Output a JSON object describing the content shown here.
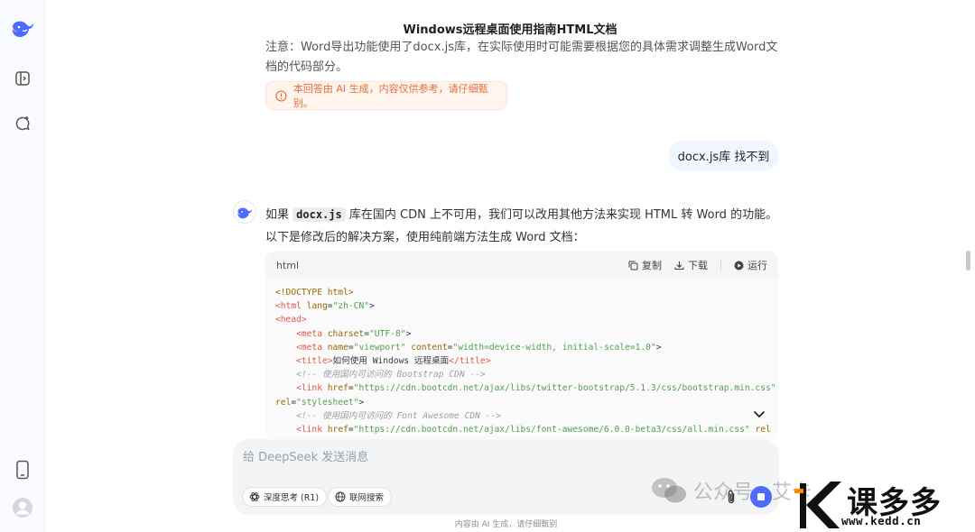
{
  "header": {
    "title": "Windows远程桌面使用指南HTML文档"
  },
  "sidebar": {
    "logo_icon": "deepseek-whale-icon",
    "toggle_icon": "sidebar-toggle-icon",
    "new_chat_icon": "new-chat-icon",
    "download_app_icon": "phone-icon",
    "profile_icon": "avatar-icon"
  },
  "chat": {
    "previous_note": "注意：Word导出功能使用了docx.js库，在实际使用时可能需要根据您的具体需求调整生成Word文档的代码部分。",
    "ai_warning": "本回答由 AI 生成，内容仅供参考，请仔细甄别。",
    "user_message": "docx.js库 找不到",
    "answer": {
      "prefix": "如果",
      "code_term": "docx.js",
      "rest": "库在国内 CDN 上不可用，我们可以改用其他方法来实现 HTML 转 Word 的功能。以下是修改后的解决方案，使用纯前端方法生成 Word 文档："
    }
  },
  "codeblock": {
    "language": "html",
    "copy_label": "复制",
    "download_label": "下载",
    "run_label": "运行",
    "lines": {
      "l1": "<!DOCTYPE html>",
      "l2_tag": "<html",
      "l2_attr": "lang",
      "l2_val": "\"zh-CN\"",
      "l3": "<head>",
      "l4_tag": "<meta",
      "l4_attr": "charset",
      "l4_val": "\"UTF-8\"",
      "l5_tag": "<meta",
      "l5_attr1": "name",
      "l5_val1": "\"viewport\"",
      "l5_attr2": "content",
      "l5_val2": "\"width=device-width, initial-scale=1.0\"",
      "l6_open": "<title>",
      "l6_text": "如何使用 Windows 远程桌面",
      "l6_close": "</title>",
      "l7": "<!-- 使用国内可访问的 Bootstrap CDN -->",
      "l8_tag": "<link",
      "l8_attr": "href",
      "l8_val": "\"https://cdn.bootcdn.net/ajax/libs/twitter-bootstrap/5.1.3/css/bootstrap.min.css\"",
      "l9_attr": "rel",
      "l9_val": "\"stylesheet\"",
      "l10": "<!-- 使用国内可访问的 Font Awesome CDN -->",
      "l11_tag": "<link",
      "l11_attr": "href",
      "l11_val": "\"https://cdn.bootcdn.net/ajax/libs/font-awesome/6.0.0-beta3/css/all.min.css\"",
      "l11_tail": "rel"
    }
  },
  "composer": {
    "placeholder": "给 DeepSeek 发送消息",
    "deep_think_label": "深度思考 (R1)",
    "web_search_label": "联网搜索"
  },
  "footer": {
    "disclaimer": "内容由 AI 生成，请仔细甄别"
  },
  "watermarks": {
    "wechat": "公众号 · 艾卡",
    "kedd_text": "课多多",
    "kedd_url": "www.kedd.cn"
  },
  "colors": {
    "accent": "#4d6bfe",
    "warning": "#e4703a",
    "user_bubble": "#eff6ff"
  }
}
